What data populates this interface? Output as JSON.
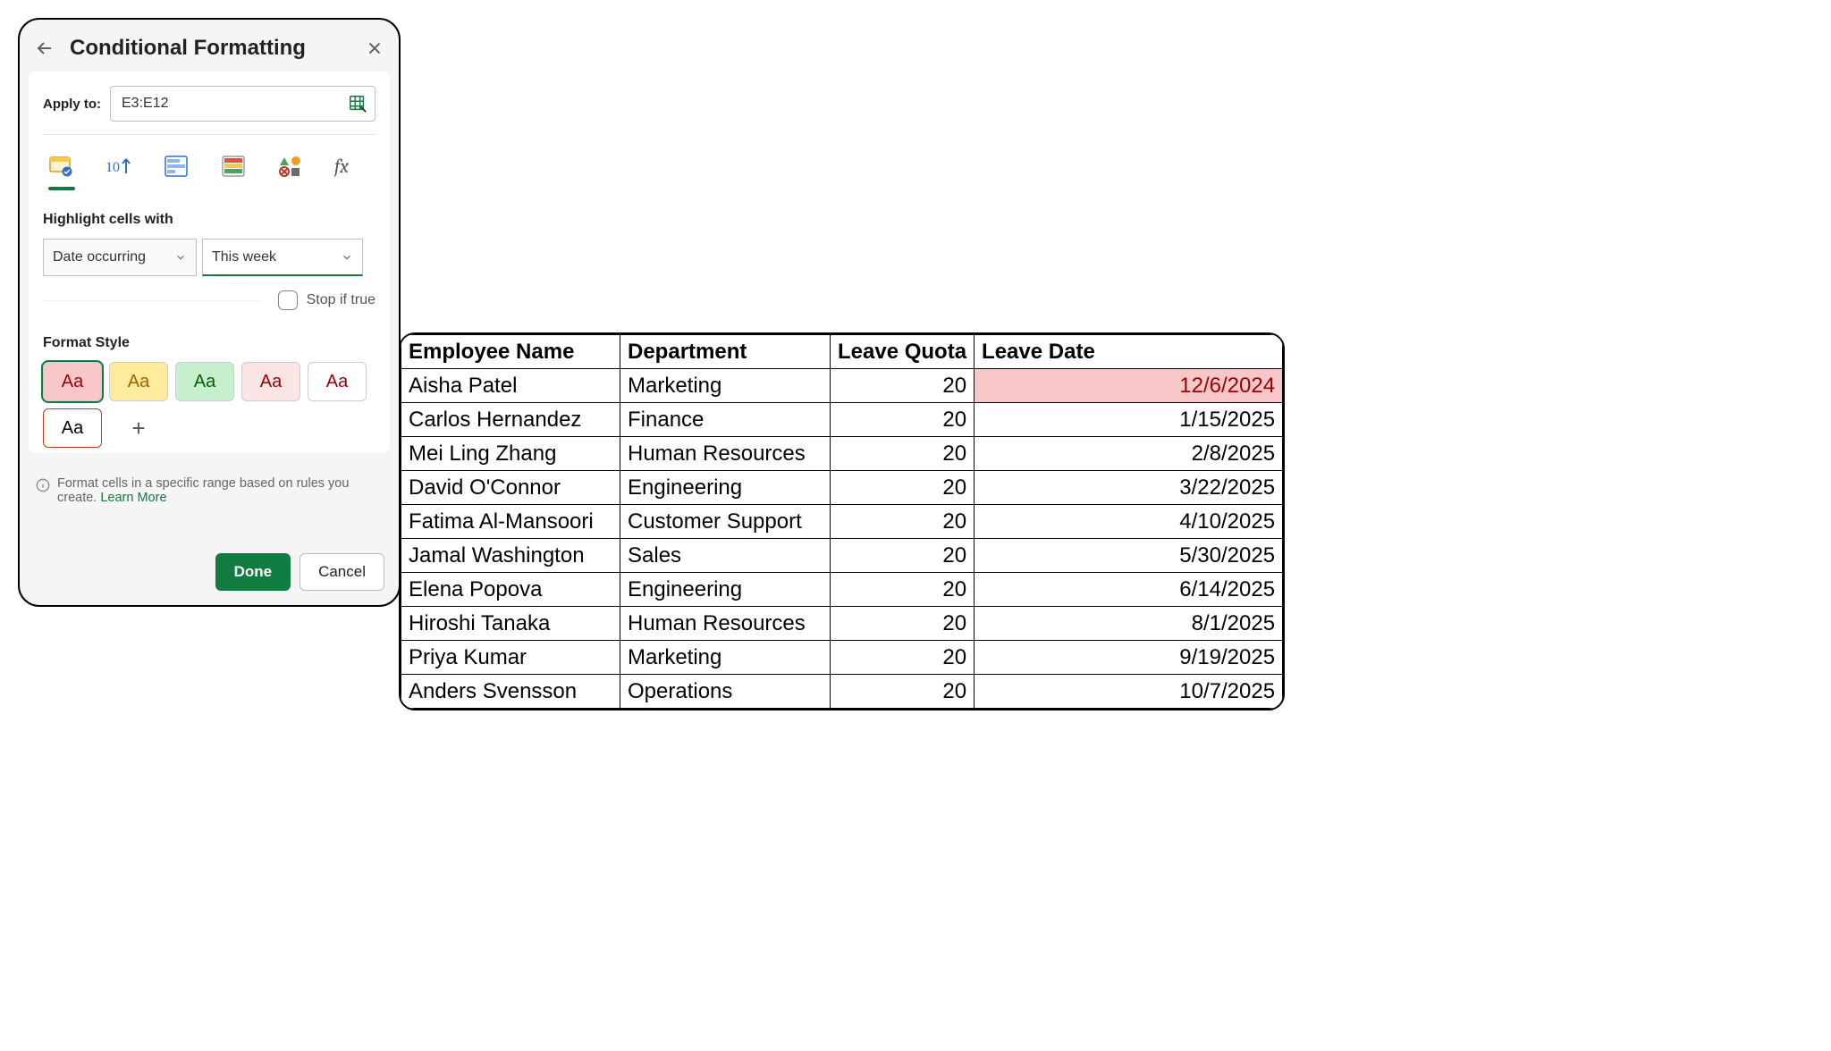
{
  "panel": {
    "title": "Conditional Formatting",
    "apply_to_label": "Apply to:",
    "apply_to_value": "E3:E12",
    "highlight_label": "Highlight cells with",
    "condition_type": "Date occurring",
    "condition_value": "This week",
    "stop_if_true_label": "Stop if true",
    "format_style_label": "Format Style",
    "swatch_text": "Aa",
    "footer_text": "Format cells in a specific range based on rules you create. ",
    "learn_more_text": "Learn More",
    "done_label": "Done",
    "cancel_label": "Cancel",
    "rule_type_top_text": "10"
  },
  "table": {
    "headers": {
      "name": "Employee Name",
      "dept": "Department",
      "quota": "Leave Quota",
      "date": "Leave Date"
    },
    "rows": [
      {
        "name": "Aisha Patel",
        "dept": "Marketing",
        "quota": "20",
        "date": "12/6/2024",
        "highlight": true
      },
      {
        "name": "Carlos Hernandez",
        "dept": "Finance",
        "quota": "20",
        "date": "1/15/2025"
      },
      {
        "name": "Mei Ling Zhang",
        "dept": "Human Resources",
        "quota": "20",
        "date": "2/8/2025"
      },
      {
        "name": "David O'Connor",
        "dept": "Engineering",
        "quota": "20",
        "date": "3/22/2025"
      },
      {
        "name": "Fatima Al-Mansoori",
        "dept": "Customer Support",
        "quota": "20",
        "date": "4/10/2025"
      },
      {
        "name": "Jamal Washington",
        "dept": "Sales",
        "quota": "20",
        "date": "5/30/2025"
      },
      {
        "name": "Elena Popova",
        "dept": "Engineering",
        "quota": "20",
        "date": "6/14/2025"
      },
      {
        "name": "Hiroshi Tanaka",
        "dept": "Human Resources",
        "quota": "20",
        "date": "8/1/2025"
      },
      {
        "name": "Priya Kumar",
        "dept": "Marketing",
        "quota": "20",
        "date": "9/19/2025"
      },
      {
        "name": "Anders Svensson",
        "dept": "Operations",
        "quota": "20",
        "date": "10/7/2025"
      }
    ]
  }
}
